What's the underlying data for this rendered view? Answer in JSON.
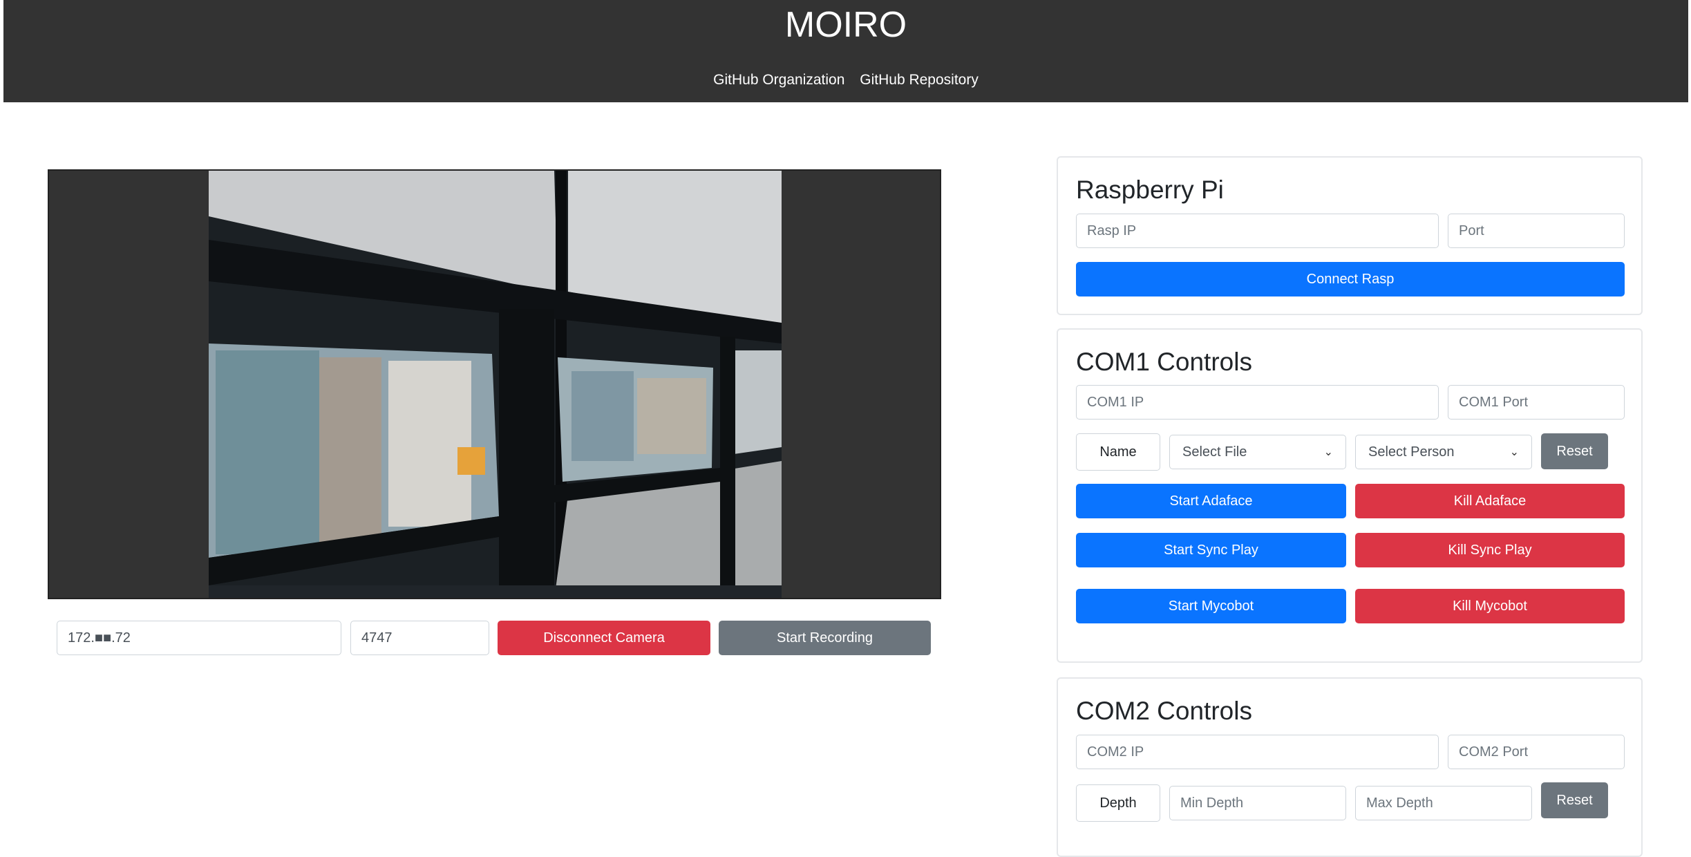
{
  "header": {
    "title": "MOIRO",
    "links": [
      "GitHub Organization",
      "GitHub Repository"
    ]
  },
  "camera": {
    "ip_value": "172.■■.72",
    "port_value": "4747",
    "disconnect_label": "Disconnect Camera",
    "record_label": "Start Recording"
  },
  "rasp": {
    "title": "Raspberry Pi",
    "ip_placeholder": "Rasp IP",
    "port_placeholder": "Port",
    "connect_label": "Connect Rasp"
  },
  "com1": {
    "title": "COM1 Controls",
    "ip_placeholder": "COM1 IP",
    "port_placeholder": "COM1 Port",
    "name_label": "Name",
    "select_file": "Select File",
    "select_person": "Select Person",
    "reset_label": "Reset",
    "start_adaface": "Start Adaface",
    "kill_adaface": "Kill Adaface",
    "start_sync": "Start Sync Play",
    "kill_sync": "Kill Sync Play",
    "start_mycobot": "Start Mycobot",
    "kill_mycobot": "Kill Mycobot"
  },
  "com2": {
    "title": "COM2 Controls",
    "ip_placeholder": "COM2 IP",
    "port_placeholder": "COM2 Port",
    "depth_label": "Depth",
    "min_placeholder": "Min Depth",
    "max_placeholder": "Max Depth",
    "reset_label": "Reset"
  },
  "colors": {
    "primary": "#0a74ff",
    "danger": "#dc3545",
    "secondary": "#6c757d",
    "header_bg": "#333333"
  }
}
